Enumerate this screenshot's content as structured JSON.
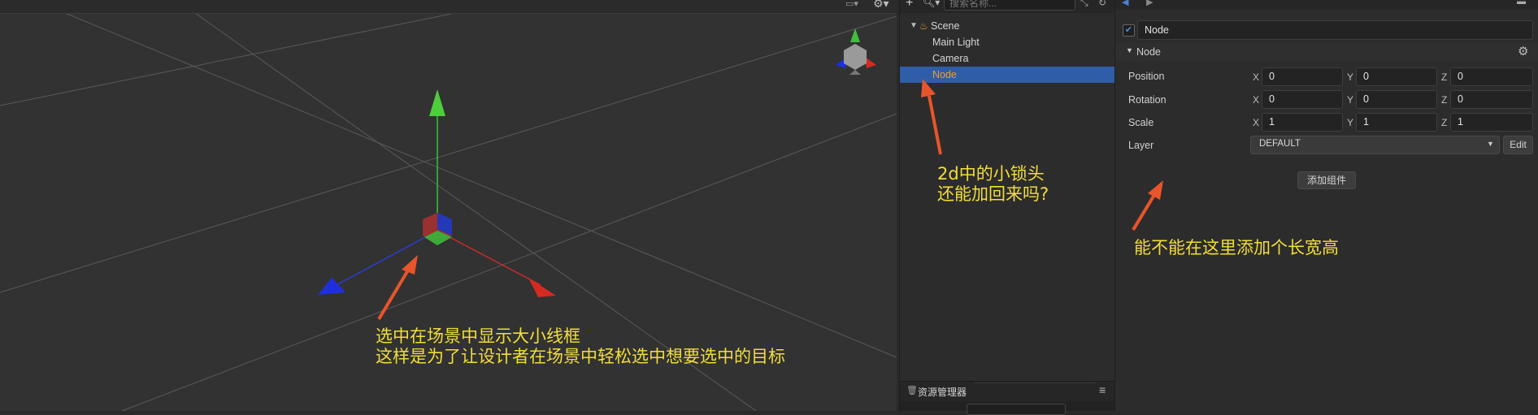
{
  "scene": {
    "annotation_line1": "选中在场景中显示大小线框",
    "annotation_line2": "这样是为了让设计者在场景中轻松选中想要选中的目标"
  },
  "hierarchy": {
    "search_placeholder": "搜索名称...",
    "items": [
      {
        "label": "Scene",
        "depth": 0,
        "selected": false
      },
      {
        "label": "Main Light",
        "depth": 1,
        "selected": false
      },
      {
        "label": "Camera",
        "depth": 1,
        "selected": false
      },
      {
        "label": "Node",
        "depth": 1,
        "selected": true
      }
    ],
    "annotation_line1": "2d中的小锁头",
    "annotation_line2": "还能加回来吗?",
    "assets_title": "资源管理器"
  },
  "inspector": {
    "node_name": "Node",
    "node_enabled": true,
    "section_title": "Node",
    "properties": [
      {
        "label": "Position",
        "x": "0",
        "y": "0",
        "z": "0"
      },
      {
        "label": "Rotation",
        "x": "0",
        "y": "0",
        "z": "0"
      },
      {
        "label": "Scale",
        "x": "1",
        "y": "1",
        "z": "1"
      }
    ],
    "axis_x": "X",
    "axis_y": "Y",
    "axis_z": "Z",
    "layer_label": "Layer",
    "layer_value": "DEFAULT",
    "edit_button": "Edit",
    "add_component": "添加组件",
    "annotation": "能不能在这里添加个长宽高"
  },
  "colors": {
    "annotation_text": "#f2de3a",
    "annotation_arrow": "#e8552a",
    "selection": "#2f5da8",
    "axis_x": "#cc2b2b",
    "axis_y": "#3fbf3f",
    "axis_z": "#2a3fd0"
  }
}
